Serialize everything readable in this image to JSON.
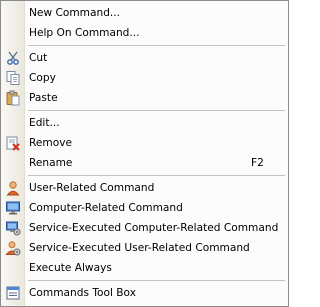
{
  "menu": {
    "items": [
      {
        "type": "item",
        "name": "new-command-item",
        "icon": "none",
        "label": "New Command..."
      },
      {
        "type": "item",
        "name": "help-on-command-item",
        "icon": "none",
        "label": "Help On Command..."
      },
      {
        "type": "separator"
      },
      {
        "type": "item",
        "name": "cut-item",
        "icon": "scissors-icon",
        "label": "Cut"
      },
      {
        "type": "item",
        "name": "copy-item",
        "icon": "copy-icon",
        "label": "Copy"
      },
      {
        "type": "item",
        "name": "paste-item",
        "icon": "clipboard-icon",
        "label": "Paste"
      },
      {
        "type": "separator"
      },
      {
        "type": "item",
        "name": "edit-item",
        "icon": "none",
        "label": "Edit..."
      },
      {
        "type": "item",
        "name": "remove-item",
        "icon": "remove-icon",
        "label": "Remove"
      },
      {
        "type": "item",
        "name": "rename-item",
        "icon": "none",
        "label": "Rename",
        "shortcut": "F2"
      },
      {
        "type": "separator"
      },
      {
        "type": "item",
        "name": "user-related-command-item",
        "icon": "user-icon",
        "label": "User-Related Command"
      },
      {
        "type": "item",
        "name": "computer-related-command-item",
        "icon": "computer-icon",
        "label": "Computer-Related Command"
      },
      {
        "type": "item",
        "name": "service-executed-computer-related-command-item",
        "icon": "service-computer-icon",
        "label": "Service-Executed Computer-Related Command"
      },
      {
        "type": "item",
        "name": "service-executed-user-related-command-item",
        "icon": "service-user-icon",
        "label": "Service-Executed User-Related Command"
      },
      {
        "type": "item",
        "name": "execute-always-item",
        "icon": "none",
        "label": "Execute Always"
      },
      {
        "type": "separator"
      },
      {
        "type": "item",
        "name": "commands-tool-box-item",
        "icon": "toolbox-icon",
        "label": "Commands Tool Box"
      }
    ]
  }
}
